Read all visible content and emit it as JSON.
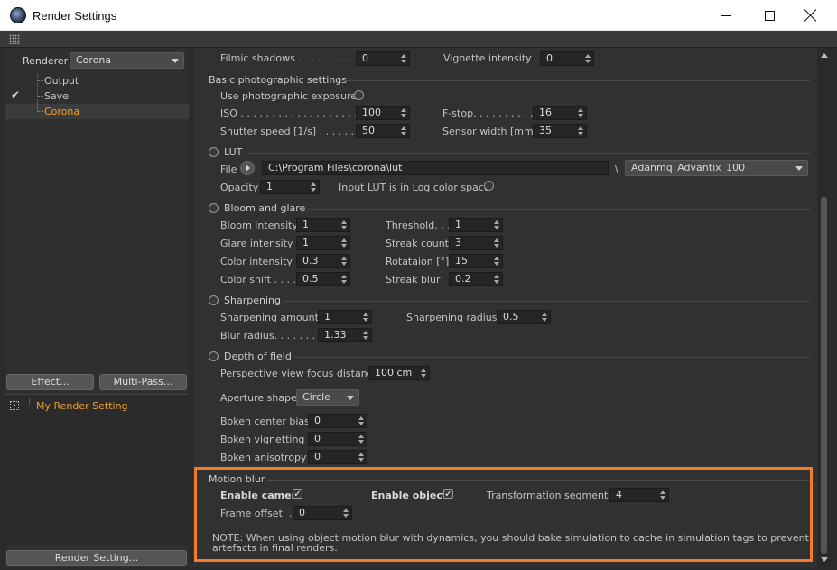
{
  "window": {
    "title": "Render Settings",
    "minimize_icon": "minimize-icon",
    "maximize_icon": "maximize-icon",
    "close_icon": "close-icon"
  },
  "colors": {
    "accent_orange": "#f0a030",
    "highlight_border": "#f07d27",
    "panel_bg": "#313131"
  },
  "sidebar": {
    "renderer_label": "Renderer",
    "renderer_value": "Corona",
    "tree": [
      {
        "label": "Output",
        "checked": false,
        "selected": false
      },
      {
        "label": "Save",
        "checked": true,
        "selected": false
      },
      {
        "label": "Corona",
        "checked": false,
        "selected": true
      }
    ],
    "effect_button": "Effect...",
    "multipass_button": "Multi-Pass...",
    "settings": [
      {
        "label": "My Render Setting"
      }
    ],
    "render_setting_button": "Render Setting..."
  },
  "main": {
    "filmic": {
      "shadows_label": "Filmic shadows . . . . . . . . . . . .",
      "shadows_value": "0",
      "vignette_label": "Vignette intensity . .",
      "vignette_value": "0"
    },
    "photo": {
      "section": "Basic photographic settings",
      "use_exposure_label": "Use photographic exposure",
      "iso_label": "ISO . . . . . . . . . . . . . . . . . . . . . . . . .",
      "iso_value": "100",
      "fstop_label": "F-stop. . . . . . . . . . . .",
      "fstop_value": "16",
      "shutter_label": "Shutter speed [1/s] . . . . . . . .",
      "shutter_value": "50",
      "sensor_label": "Sensor width [mm]",
      "sensor_value": "35"
    },
    "lut": {
      "section": "LUT",
      "file_label": "File",
      "file_value": "C:\\Program Files\\corona\\lut",
      "backslash": "\\",
      "preset_value": "Adanmq_Advantix_100",
      "opacity_label": "Opacity",
      "opacity_value": "1",
      "log_label": "Input LUT is in Log color space"
    },
    "bloom": {
      "section": "Bloom and glare",
      "bloom_intensity_label": "Bloom intensity",
      "bloom_intensity_value": "1",
      "threshold_label": "Threshold. . .",
      "threshold_value": "1",
      "glare_intensity_label": "Glare intensity",
      "glare_intensity_value": "1",
      "streak_count_label": "Streak count",
      "streak_count_value": "3",
      "color_intensity_label": "Color intensity",
      "color_intensity_value": "0.3",
      "rotation_label": "Rotataion [°]",
      "rotation_value": "15",
      "color_shift_label": "Color shift . . . .",
      "color_shift_value": "0.5",
      "streak_blur_label": "Streak blur",
      "streak_blur_value": "0.2"
    },
    "sharpen": {
      "section": "Sharpening",
      "amount_label": "Sharpening amount",
      "amount_value": "1",
      "radius_label": "Sharpening radius",
      "radius_value": "0.5",
      "blur_label": "Blur radius. . . . . . . . .",
      "blur_value": "1.33"
    },
    "dof": {
      "section": "Depth of field",
      "focus_label": "Perspective view focus distance",
      "focus_value": "100 cm",
      "aperture_label": "Aperture shape",
      "aperture_value": "Circle",
      "bokeh_bias_label": "Bokeh center bias",
      "bokeh_bias_value": "0",
      "bokeh_vig_label": "Bokeh vignetting",
      "bokeh_vig_value": "0",
      "bokeh_aniso_label": "Bokeh anisotropy",
      "bokeh_aniso_value": "0"
    },
    "motion": {
      "section": "Motion blur",
      "enable_camera_label": "Enable camera",
      "enable_objects_label": "Enable objects",
      "segments_label": "Transformation segments",
      "segments_value": "4",
      "frame_offset_label": "Frame offset  .",
      "frame_offset_value": "0",
      "note_line1": "NOTE: When using object motion blur with dynamics, you should bake simulation to cache in simulation tags to prevent",
      "note_line2": "artefacts in final renders."
    }
  }
}
